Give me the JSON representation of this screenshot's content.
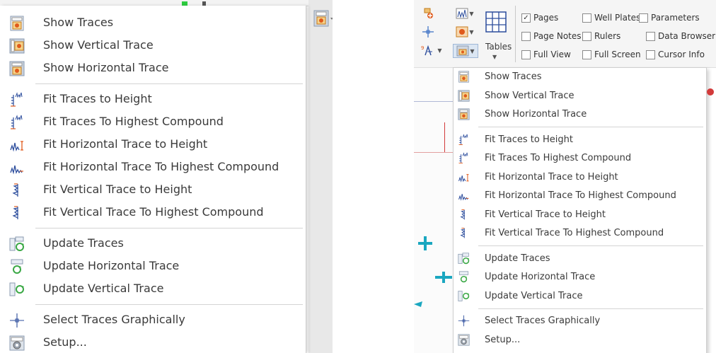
{
  "menu_items": [
    {
      "label": "Show Traces",
      "icon": "show-traces-icon"
    },
    {
      "label": "Show Vertical Trace",
      "icon": "show-vertical-trace-icon"
    },
    {
      "label": "Show Horizontal Trace",
      "icon": "show-horizontal-trace-icon"
    },
    {
      "label": "Fit Traces to Height",
      "icon": "fit-traces-height-icon"
    },
    {
      "label": "Fit Traces To Highest Compound",
      "icon": "fit-traces-highest-icon"
    },
    {
      "label": "Fit Horizontal Trace to Height",
      "icon": "fit-horizontal-height-icon"
    },
    {
      "label": "Fit Horizontal Trace To Highest Compound",
      "icon": "fit-horizontal-highest-icon"
    },
    {
      "label": "Fit Vertical Trace to Height",
      "icon": "fit-vertical-height-icon"
    },
    {
      "label": "Fit Vertical Trace To Highest Compound",
      "icon": "fit-vertical-highest-icon"
    },
    {
      "label": "Update Traces",
      "icon": "update-traces-icon"
    },
    {
      "label": "Update Horizontal Trace",
      "icon": "update-horizontal-trace-icon"
    },
    {
      "label": "Update Vertical Trace",
      "icon": "update-vertical-trace-icon"
    },
    {
      "label": "Select Traces Graphically",
      "icon": "crosshair-icon"
    },
    {
      "label": "Setup...",
      "icon": "setup-icon"
    }
  ],
  "ribbon": {
    "tables_label": "Tables",
    "checkboxes": [
      {
        "label": "Pages",
        "checked": true
      },
      {
        "label": "Well Plates",
        "checked": false
      },
      {
        "label": "Parameters",
        "checked": false
      },
      {
        "label": "Page Notes",
        "checked": false
      },
      {
        "label": "Rulers",
        "checked": false
      },
      {
        "label": "Data Browser",
        "checked": false
      },
      {
        "label": "Full View",
        "checked": false
      },
      {
        "label": "Full Screen",
        "checked": false
      },
      {
        "label": "Cursor Info",
        "checked": false
      }
    ]
  },
  "colors": {
    "accent": "#e05a1c",
    "trace_blue": "#2b4c9c",
    "update_green": "#3aa845"
  }
}
